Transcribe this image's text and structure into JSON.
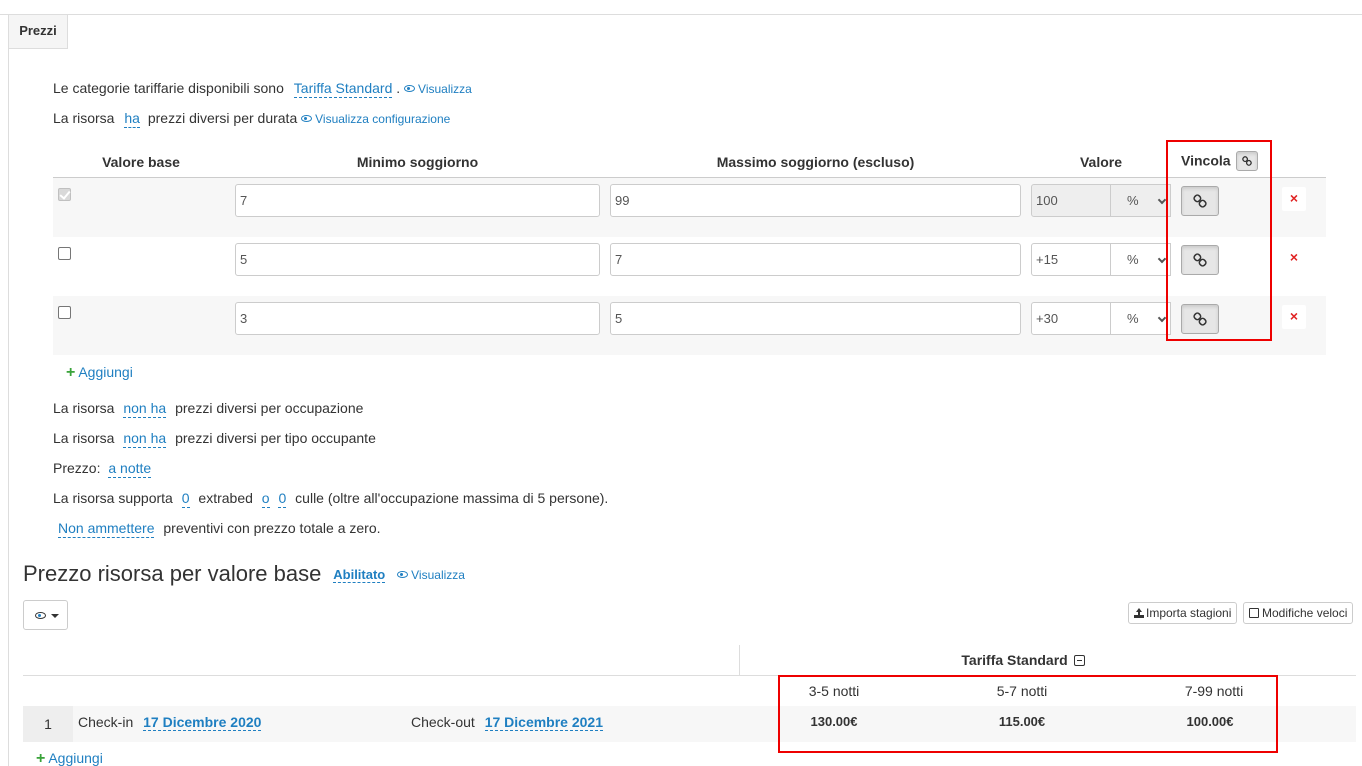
{
  "tab": {
    "label": "Prezzi"
  },
  "info": {
    "categories_text": "Le categorie tariffarie disponibili sono",
    "categories_link": "Tariffa Standard",
    "categories_dot": ".",
    "visualizza": "Visualizza",
    "duration_prefix": "La risorsa",
    "duration_value": "ha",
    "duration_suffix": "prezzi diversi per durata",
    "visualizza_config": "Visualizza configurazione"
  },
  "table": {
    "headers": {
      "base": "Valore base",
      "min": "Minimo soggiorno",
      "max": "Massimo soggiorno (escluso)",
      "value": "Valore",
      "link": "Vincola"
    },
    "rows": [
      {
        "base_checked": true,
        "min": "7",
        "max": "99",
        "value": "100",
        "unit": "%"
      },
      {
        "base_checked": false,
        "min": "5",
        "max": "7",
        "value": "+15",
        "unit": "%"
      },
      {
        "base_checked": false,
        "min": "3",
        "max": "5",
        "value": "+30",
        "unit": "%"
      }
    ],
    "delete_icon": "×",
    "add_label": "Aggiungi"
  },
  "options": {
    "occupancy_prefix": "La risorsa",
    "occupancy_value": "non ha",
    "occupancy_suffix": "prezzi diversi per occupazione",
    "type_prefix": "La risorsa",
    "type_value": "non ha",
    "type_suffix": "prezzi diversi per tipo occupante",
    "price_label": "Prezzo:",
    "price_value": "a notte",
    "extra_prefix": "La risorsa supporta",
    "extrabed_count": "0",
    "extrabed_label": "extrabed",
    "or_label": "o",
    "cribs_count": "0",
    "cribs_suffix": "culle (oltre all'occupazione massima di 5 persone).",
    "zero_value": "Non ammettere",
    "zero_suffix": "preventivi con prezzo totale a zero."
  },
  "base_section": {
    "title": "Prezzo risorsa per valore base",
    "status": "Abilitato",
    "visualizza": "Visualizza",
    "import_button": "Importa stagioni",
    "quick_edit_button": "Modifiche veloci",
    "tariff_header": "Tariffa Standard",
    "columns": [
      "3-5 notti",
      "5-7 notti",
      "7-99 notti"
    ],
    "rows": [
      {
        "index": "1",
        "checkin_label": "Check-in",
        "checkin": "17 Dicembre 2020",
        "checkout_label": "Check-out",
        "checkout": "17 Dicembre 2021",
        "prices": [
          "130.00€",
          "115.00€",
          "100.00€"
        ]
      }
    ],
    "add_label": "Aggiungi"
  },
  "colors": {
    "accent": "#1f7fc1",
    "danger": "#e02222",
    "highlight": "#e00000",
    "add": "#3aa33a"
  }
}
